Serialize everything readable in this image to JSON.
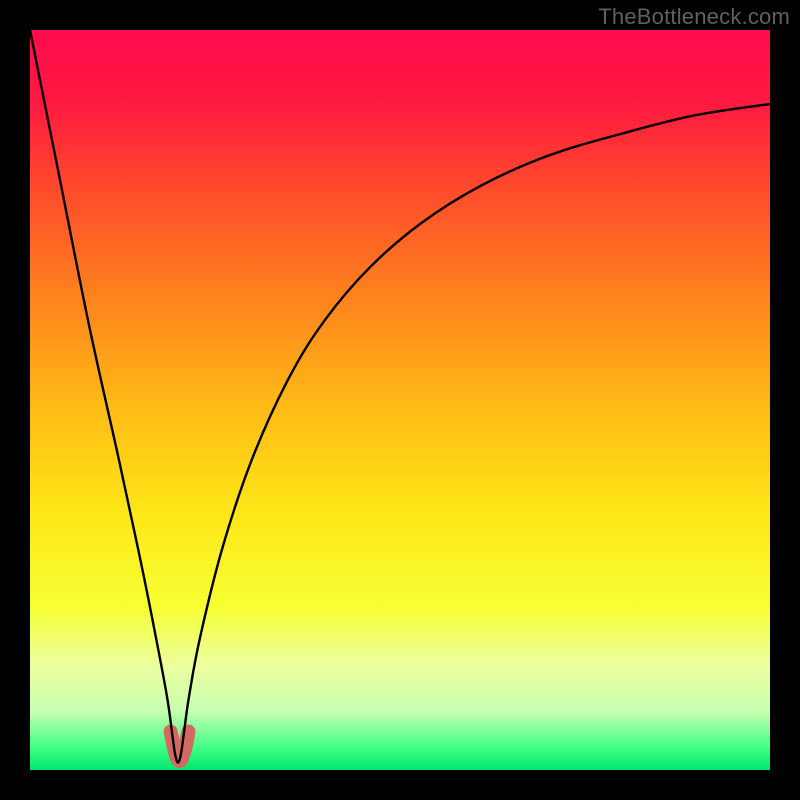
{
  "watermark": "TheBottleneck.com",
  "gradient": {
    "stops": [
      {
        "offset": 0.0,
        "color": "#ff0b4e"
      },
      {
        "offset": 0.1,
        "color": "#ff1a3f"
      },
      {
        "offset": 0.22,
        "color": "#ff4d2b"
      },
      {
        "offset": 0.35,
        "color": "#ff7e1e"
      },
      {
        "offset": 0.5,
        "color": "#ffb716"
      },
      {
        "offset": 0.65,
        "color": "#ffe617"
      },
      {
        "offset": 0.78,
        "color": "#f6ff33"
      },
      {
        "offset": 0.86,
        "color": "#ecffa0"
      },
      {
        "offset": 0.92,
        "color": "#c8ffb0"
      },
      {
        "offset": 0.97,
        "color": "#40ff86"
      },
      {
        "offset": 1.0,
        "color": "#00e66b"
      }
    ]
  },
  "chart_data": {
    "type": "line",
    "title": "",
    "xlabel": "",
    "ylabel": "",
    "xlim": [
      0,
      100
    ],
    "ylim": [
      0,
      100
    ],
    "series": [
      {
        "name": "bottleneck-curve",
        "x": [
          0,
          4,
          8,
          12,
          15,
          17,
          18.5,
          19.2,
          19.6,
          20.0,
          20.4,
          20.8,
          21.5,
          23,
          26,
          30,
          35,
          40,
          46,
          53,
          61,
          70,
          80,
          90,
          100
        ],
        "values": [
          100,
          80,
          60,
          42,
          28,
          18,
          10,
          5,
          2.2,
          1,
          2.2,
          5,
          10,
          18,
          30,
          42,
          53,
          61,
          68,
          74,
          79,
          83,
          86,
          88.5,
          90
        ]
      }
    ],
    "marker": {
      "name": "optimal-region",
      "x": [
        19.0,
        19.6,
        20.2,
        20.8,
        21.4,
        21.0,
        20.4,
        19.8,
        19.0
      ],
      "values": [
        5.2,
        2.4,
        1.2,
        2.4,
        5.2,
        3.0,
        1.6,
        2.0,
        5.2
      ],
      "color": "#d36a61",
      "stroke_width": 14
    }
  }
}
